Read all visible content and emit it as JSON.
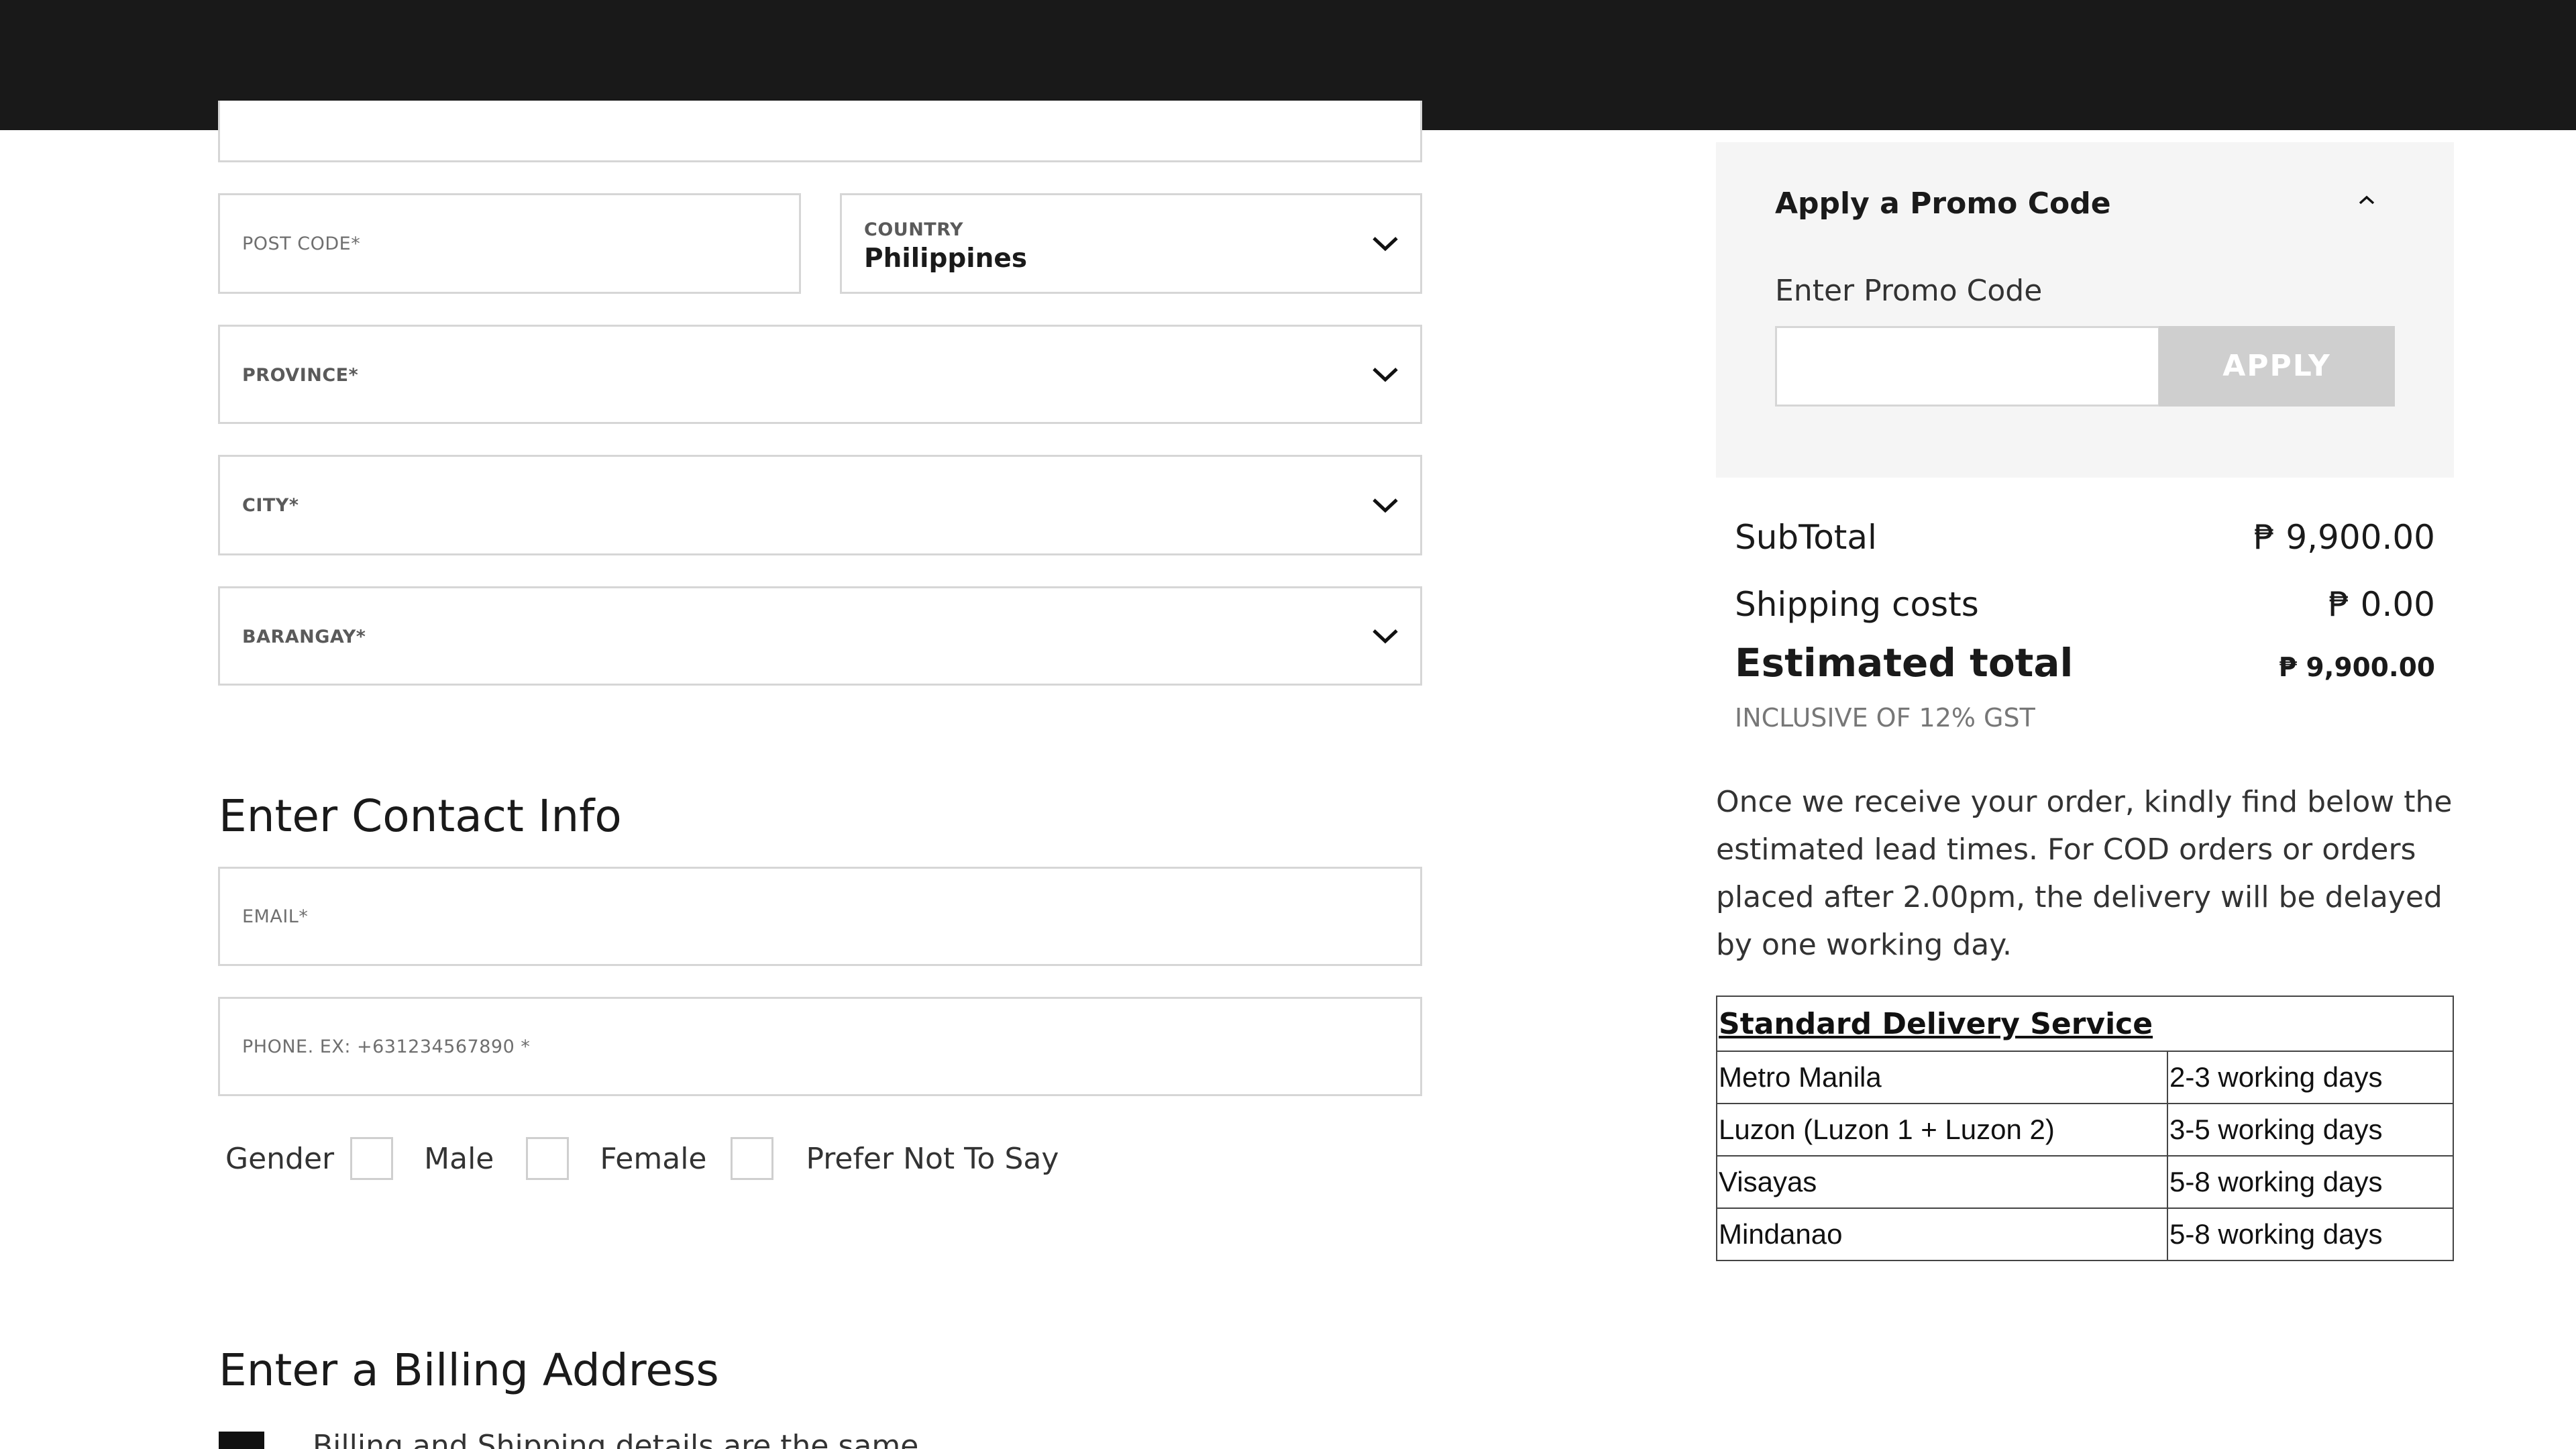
{
  "address_form": {
    "post_code_label": "POST CODE*",
    "country_label": "COUNTRY",
    "country_value": "Philippines",
    "province_label": "PROVINCE*",
    "city_label": "CITY*",
    "barangay_label": "BARANGAY*"
  },
  "contact": {
    "title": "Enter Contact Info",
    "email_label": "EMAIL*",
    "phone_label": "PHONE. EX: +631234567890 *",
    "gender_label": "Gender",
    "options": [
      "Male",
      "Female",
      "Prefer Not To Say"
    ]
  },
  "billing": {
    "title": "Enter a Billing Address",
    "same_as_shipping_label": "Billing and Shipping details are the same"
  },
  "promo": {
    "title": "Apply a Promo Code",
    "input_label": "Enter Promo Code",
    "apply_label": "APPLY"
  },
  "summary": {
    "subtotal_label": "SubTotal",
    "subtotal_value": "₱ 9,900.00",
    "shipping_label": "Shipping costs",
    "shipping_value": "₱ 0.00",
    "total_label": "Estimated total",
    "total_value": "₱ 9,900.00",
    "tax_note": "INCLUSIVE OF 12% GST"
  },
  "lead_times": {
    "intro": "Once we receive your order, kindly find below the estimated lead times. For COD orders or orders placed after 2.00pm, the delivery will be delayed by one working day.",
    "table_title": "Standard Delivery Service",
    "rows": [
      {
        "region": "Metro Manila",
        "time": "2-3 working days"
      },
      {
        "region": "Luzon (Luzon 1 + Luzon 2)",
        "time": "3-5 working days"
      },
      {
        "region": "Visayas",
        "time": "5-8 working days"
      },
      {
        "region": "Mindanao",
        "time": "5-8 working days"
      }
    ]
  },
  "colors": {
    "top_bar": "#191919",
    "promo_panel": "#f5f5f5",
    "apply_button": "#cfcfcf",
    "field_border": "#d6d6d6"
  },
  "icons": {
    "dropdown": "chevron-down-icon",
    "collapse": "chevron-up-icon"
  }
}
